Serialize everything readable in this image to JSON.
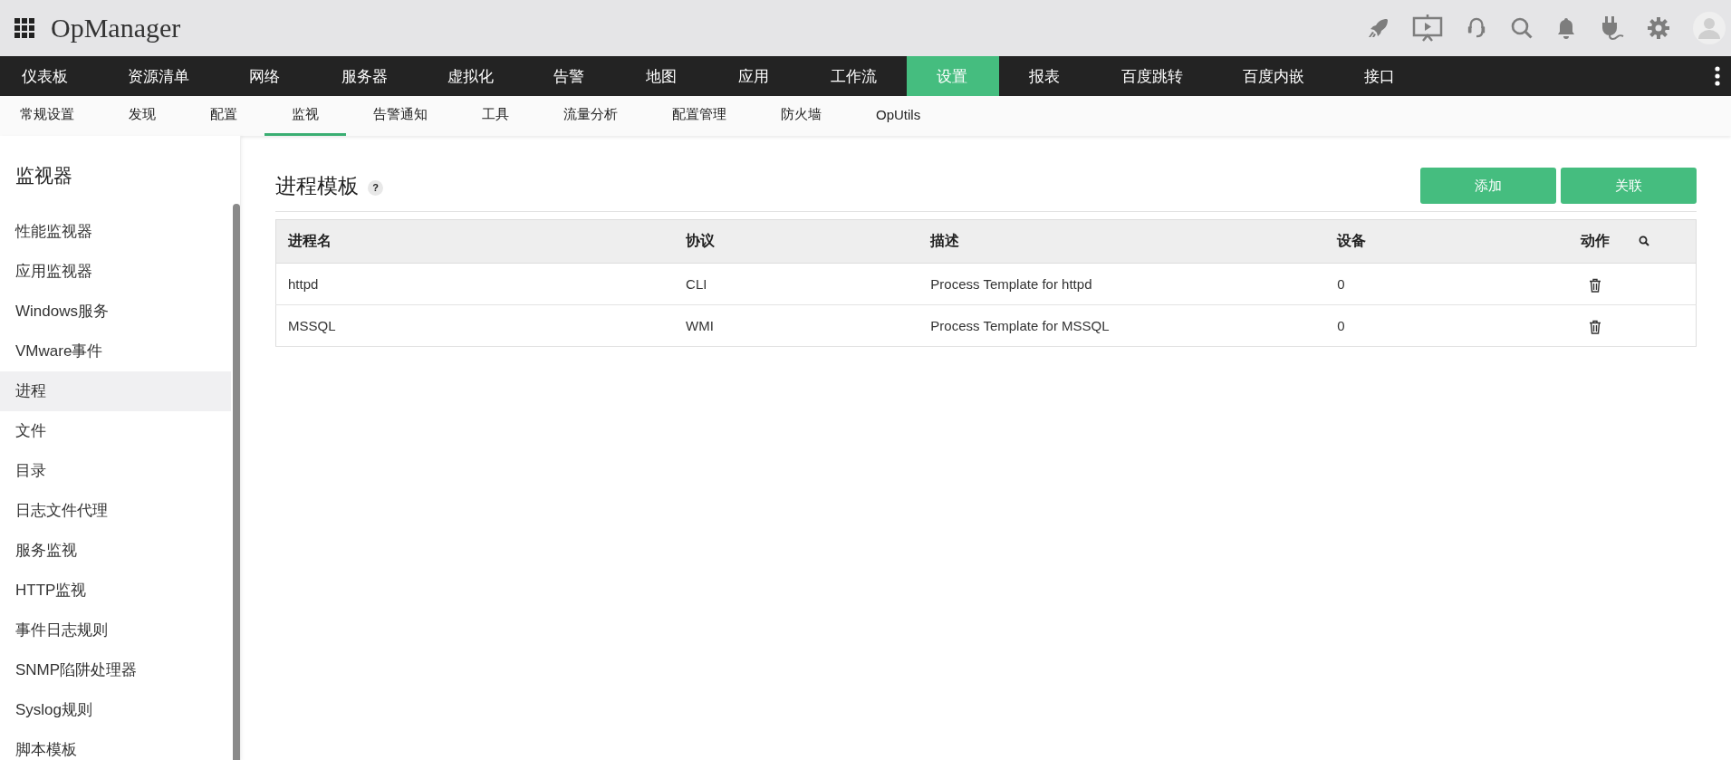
{
  "app": {
    "title": "OpManager"
  },
  "main_nav": [
    {
      "label": "仪表板",
      "selected": false
    },
    {
      "label": "资源清单",
      "selected": false
    },
    {
      "label": "网络",
      "selected": false
    },
    {
      "label": "服务器",
      "selected": false
    },
    {
      "label": "虚拟化",
      "selected": false
    },
    {
      "label": "告警",
      "selected": false
    },
    {
      "label": "地图",
      "selected": false
    },
    {
      "label": "应用",
      "selected": false
    },
    {
      "label": "工作流",
      "selected": false
    },
    {
      "label": "设置",
      "selected": true
    },
    {
      "label": "报表",
      "selected": false
    },
    {
      "label": "百度跳转",
      "selected": false
    },
    {
      "label": "百度内嵌",
      "selected": false
    },
    {
      "label": "接口",
      "selected": false
    }
  ],
  "sub_nav": [
    {
      "label": "常规设置",
      "selected": false
    },
    {
      "label": "发现",
      "selected": false
    },
    {
      "label": "配置",
      "selected": false
    },
    {
      "label": "监视",
      "selected": true
    },
    {
      "label": "告警通知",
      "selected": false
    },
    {
      "label": "工具",
      "selected": false
    },
    {
      "label": "流量分析",
      "selected": false
    },
    {
      "label": "配置管理",
      "selected": false
    },
    {
      "label": "防火墙",
      "selected": false
    },
    {
      "label": "OpUtils",
      "selected": false
    }
  ],
  "sidebar": {
    "title": "监视器",
    "items": [
      {
        "label": "性能监视器",
        "selected": false
      },
      {
        "label": "应用监视器",
        "selected": false
      },
      {
        "label": "Windows服务",
        "selected": false
      },
      {
        "label": "VMware事件",
        "selected": false
      },
      {
        "label": "进程",
        "selected": true
      },
      {
        "label": "文件",
        "selected": false
      },
      {
        "label": "目录",
        "selected": false
      },
      {
        "label": "日志文件代理",
        "selected": false
      },
      {
        "label": "服务监视",
        "selected": false
      },
      {
        "label": "HTTP监视",
        "selected": false
      },
      {
        "label": "事件日志规则",
        "selected": false
      },
      {
        "label": "SNMP陷阱处理器",
        "selected": false
      },
      {
        "label": "Syslog规则",
        "selected": false
      },
      {
        "label": "脚本模板",
        "selected": false
      }
    ]
  },
  "page": {
    "title": "进程模板",
    "help": "?",
    "buttons": [
      "添加",
      "关联"
    ]
  },
  "table": {
    "columns": [
      "进程名",
      "协议",
      "描述",
      "设备",
      "动作"
    ],
    "rows": [
      {
        "cells": [
          "httpd",
          "CLI",
          "Process Template for httpd",
          "0"
        ]
      },
      {
        "cells": [
          "MSSQL",
          "WMI",
          "Process Template for MSSQL",
          "0"
        ]
      }
    ]
  }
}
